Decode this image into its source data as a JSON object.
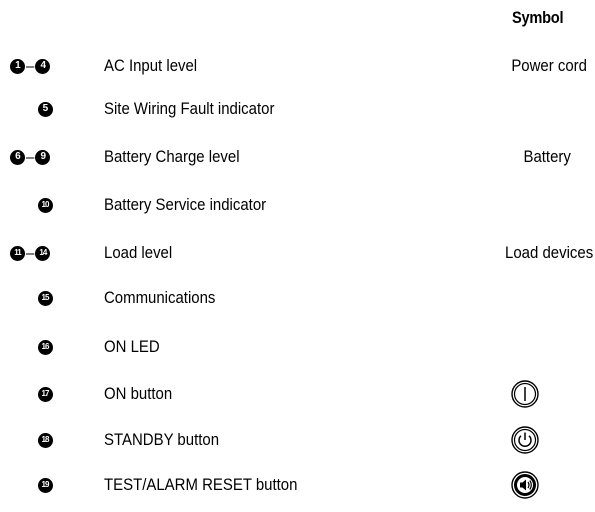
{
  "header": {
    "symbol": "Symbol"
  },
  "rows": [
    {
      "num_start": "1",
      "num_end": "4",
      "label": "AC Input level",
      "symbol_text": "Power cord"
    },
    {
      "num_start": "5",
      "label": "Site Wiring Fault indicator"
    },
    {
      "num_start": "6",
      "num_end": "9",
      "label": "Battery Charge level",
      "symbol_text": "Battery"
    },
    {
      "num_start": "10",
      "label": "Battery Service indicator"
    },
    {
      "num_start": "11",
      "num_end": "14",
      "label": "Load level",
      "symbol_text": "Load devices"
    },
    {
      "num_start": "15",
      "label": "Communications"
    },
    {
      "num_start": "16",
      "label": "ON LED"
    },
    {
      "num_start": "17",
      "label": "ON button",
      "symbol_icon": "power-on-icon"
    },
    {
      "num_start": "18",
      "label": "STANDBY button",
      "symbol_icon": "standby-icon"
    },
    {
      "num_start": "19",
      "label": "TEST/ALARM RESET button",
      "symbol_icon": "test-alarm-reset-icon"
    }
  ]
}
